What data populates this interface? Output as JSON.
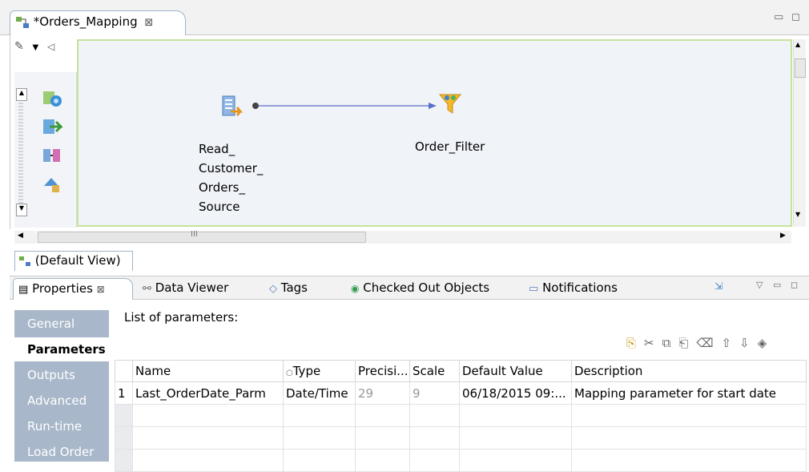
{
  "editor": {
    "tab_title": "*Orders_Mapping",
    "close_glyph": "⊠",
    "view_tab_label": "(Default View)",
    "scroll_grip": "III"
  },
  "diagram": {
    "source": {
      "lines": [
        "Read_",
        "Customer_",
        "Orders_",
        "Source"
      ]
    },
    "filter": {
      "label": "Order_Filter"
    }
  },
  "bottom_tabs": [
    {
      "label": "Properties",
      "active": true
    },
    {
      "label": "Data Viewer"
    },
    {
      "label": "Tags"
    },
    {
      "label": "Checked Out Objects"
    },
    {
      "label": "Notifications"
    }
  ],
  "properties_nav": [
    {
      "label": "General"
    },
    {
      "label": "Parameters",
      "active": true
    },
    {
      "label": "Outputs"
    },
    {
      "label": "Advanced"
    },
    {
      "label": "Run-time"
    },
    {
      "label": "Load Order"
    }
  ],
  "parameters": {
    "list_label": "List of parameters:",
    "columns": [
      "Name",
      "Type",
      "Precisi...",
      "Scale",
      "Default Value",
      "Description"
    ],
    "rows": [
      {
        "num": "1",
        "name": "Last_OrderDate_Parm",
        "type": "Date/Time",
        "precision": "29",
        "scale": "9",
        "default_value": "06/18/2015 09:...",
        "description": "Mapping parameter for start date"
      }
    ]
  },
  "colors": {
    "nav_bg": "#a8b7c9",
    "diagram_border": "#c6e39a",
    "diagram_bg": "#f0f3f8",
    "link": "#5b6ec7"
  }
}
